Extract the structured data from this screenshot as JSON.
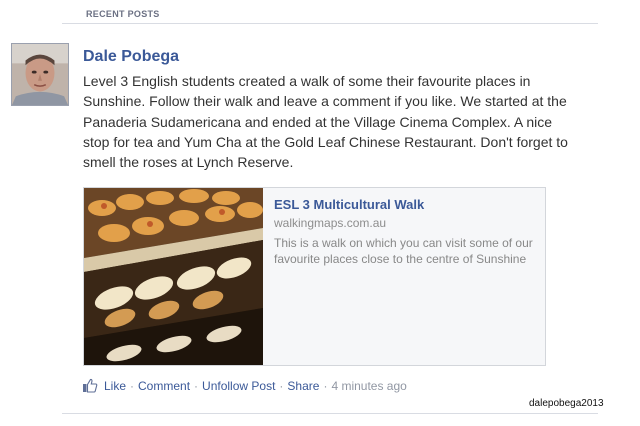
{
  "section": {
    "title": "RECENT POSTS"
  },
  "post": {
    "author": "Dale Pobega",
    "message": "Level 3 English students created a walk of some their favourite places in Sunshine. Follow their walk and leave a comment if you like. We started at the Panaderia Sudamericana and ended at the Village Cinema Complex. A nice stop for tea and Yum Cha at the Gold Leaf Chinese Restaurant. Don't forget to smell the roses at Lynch Reserve.",
    "share": {
      "title": "ESL 3 Multicultural Walk",
      "domain": "walkingmaps.com.au",
      "description": "This is a walk on which you can visit some of our favourite places close to the centre of Sunshine"
    },
    "actions": {
      "like": "Like",
      "comment": "Comment",
      "unfollow": "Unfollow Post",
      "share": "Share",
      "separator": "·",
      "timestamp": "4 minutes ago"
    }
  },
  "watermark": "dalepobega2013",
  "icons": {
    "like": "like-thumb-icon"
  },
  "colors": {
    "link": "#3b5998",
    "muted": "#9197a3",
    "text": "#333333"
  }
}
